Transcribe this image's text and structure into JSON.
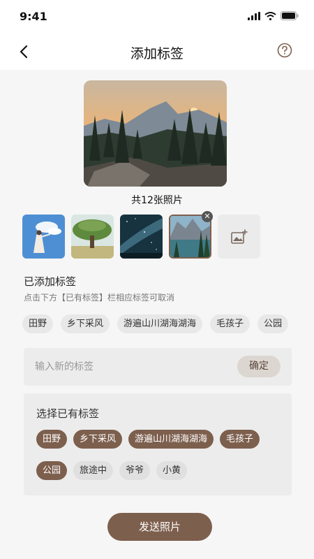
{
  "status": {
    "time": "9:41"
  },
  "nav": {
    "title": "添加标签"
  },
  "photos": {
    "count_label": "共12张照片"
  },
  "added_section": {
    "title": "已添加标签",
    "hint": "点击下方【已有标签】栏相应标签可取消",
    "tags": [
      "田野",
      "乡下采风",
      "游遍山川湖海湖海",
      "毛孩子",
      "公园"
    ]
  },
  "new_tag": {
    "placeholder": "输入新的标签",
    "confirm_label": "确定"
  },
  "existing": {
    "title": "选择已有标签",
    "row1": [
      "田野",
      "乡下采风",
      "游遍山川湖海湖海",
      "毛孩子"
    ],
    "row2": [
      "公园",
      "旅途中",
      "爷爷",
      "小黄"
    ]
  },
  "send_label": "发送照片",
  "colors": {
    "accent": "#7d5f4e",
    "chip_bg": "#e0e0e0",
    "panel_bg": "#ececec"
  }
}
